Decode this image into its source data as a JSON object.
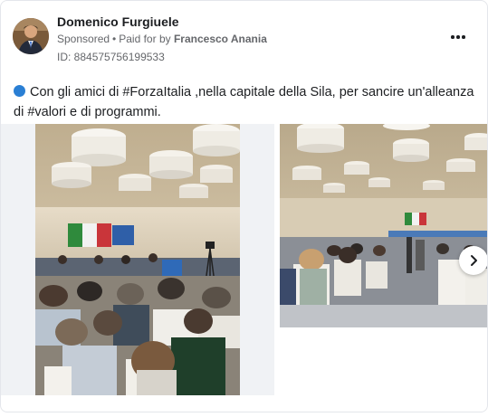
{
  "post": {
    "author": "Domenico Furgiuele",
    "sponsored": "Sponsored",
    "dot": "•",
    "paid_for_by": "Paid for by",
    "payer": "Francesco Anania",
    "ad_id": "ID: 884575756199533",
    "text": "Con gli amici di #ForzaItalia ,nella capitale della Sila, per sancire un'alleanza di #valori e di programmi."
  },
  "icons": {
    "more": "more-options-icon",
    "next": "chevron-right-icon",
    "bullet": "blue-circle-icon"
  },
  "colors": {
    "text": "#1c1e21",
    "secondary": "#65676b",
    "bullet_blue": "#2a7fd4"
  }
}
